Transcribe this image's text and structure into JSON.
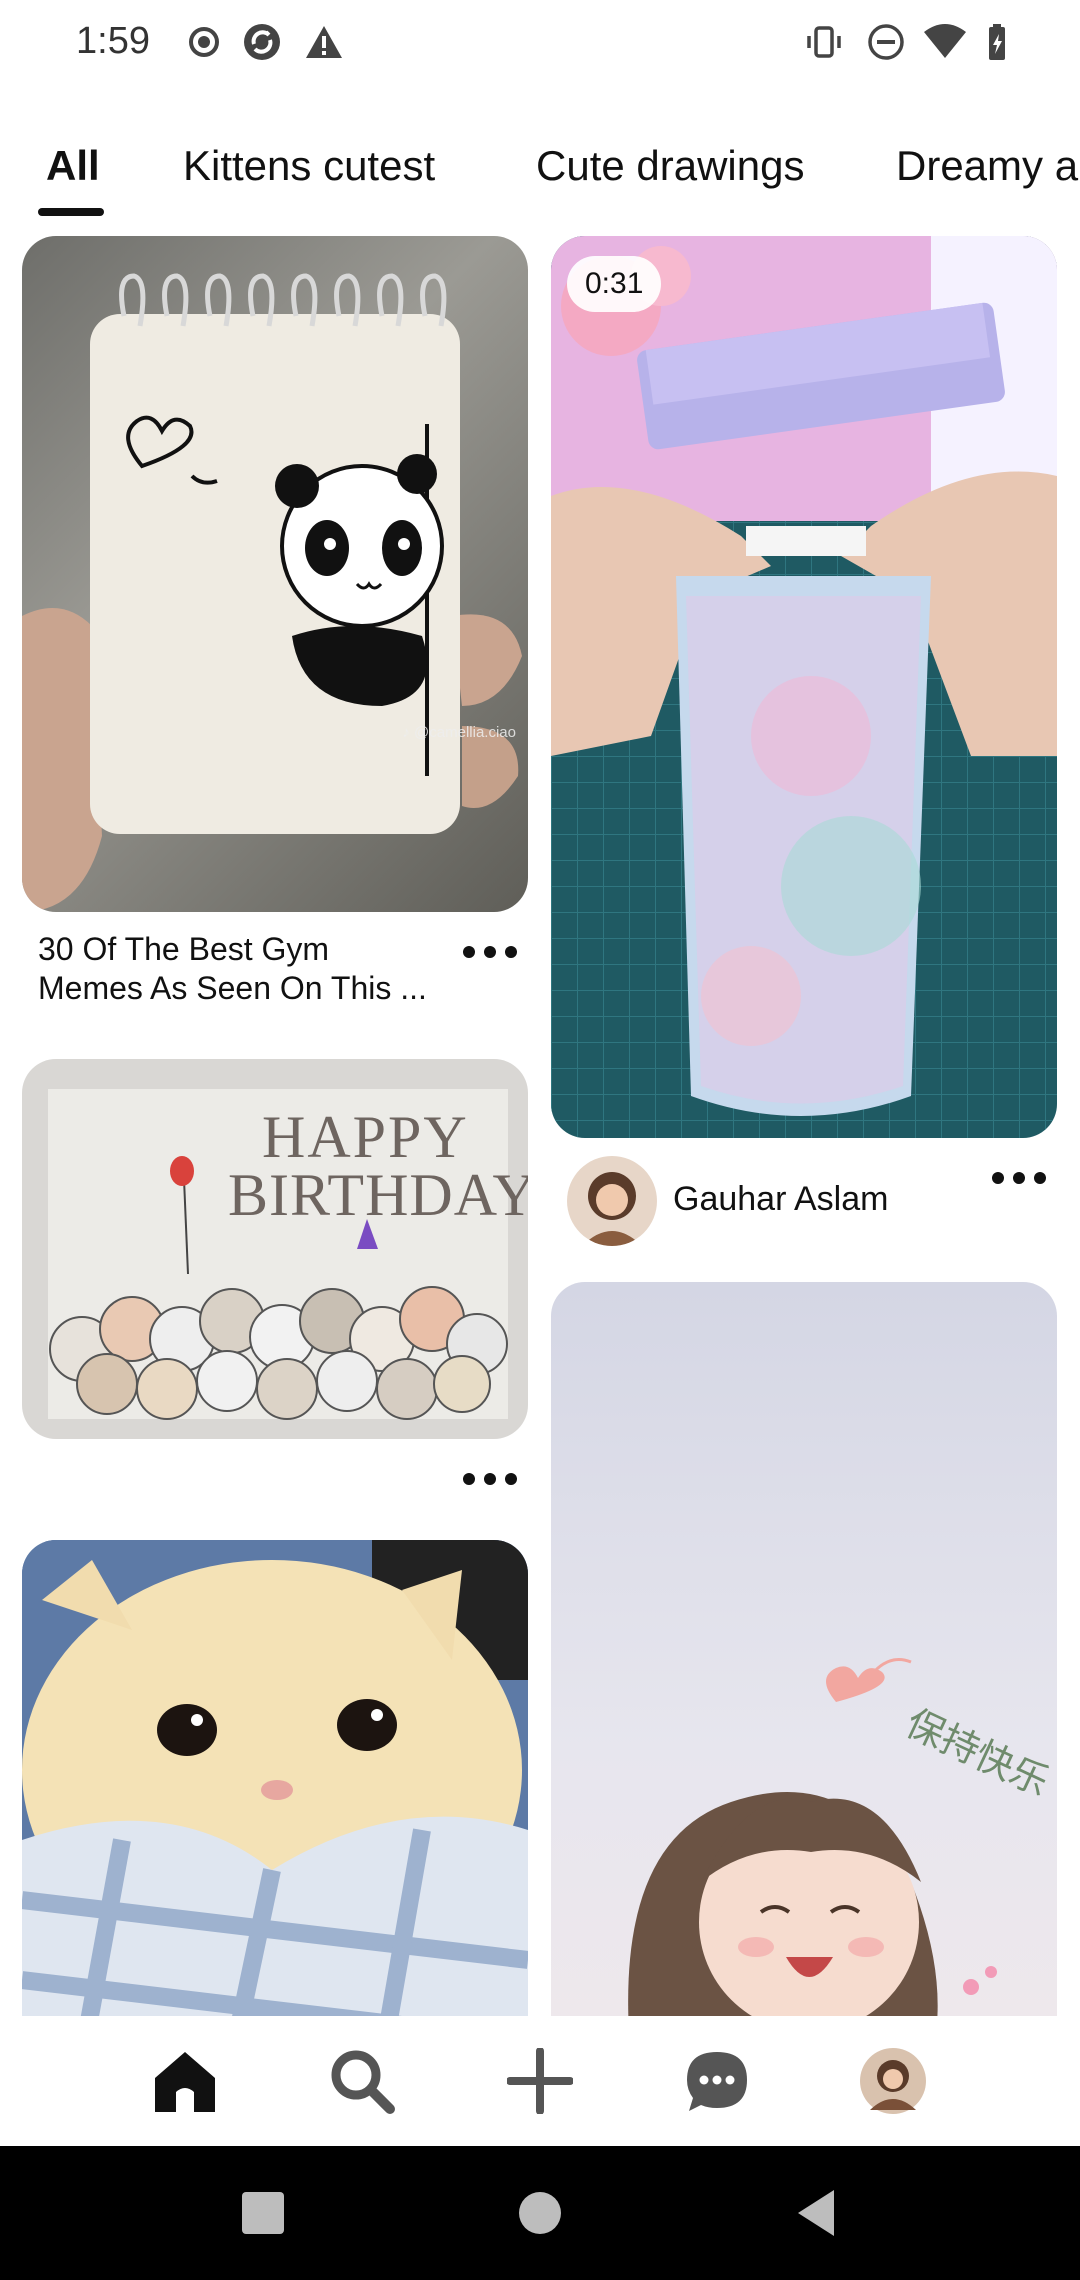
{
  "status_bar": {
    "time": "1:59",
    "icons_left": [
      "record-icon",
      "sync-icon",
      "warning-icon"
    ],
    "icons_right": [
      "vibrate-icon",
      "do-not-disturb-icon",
      "wifi-icon",
      "battery-charging-icon"
    ]
  },
  "tabs": [
    {
      "label": "All",
      "active": true
    },
    {
      "label": "Kittens cutest",
      "active": false
    },
    {
      "label": "Cute drawings",
      "active": false
    },
    {
      "label": "Dreamy a",
      "active": false
    }
  ],
  "feed": {
    "pin1": {
      "title_line1": "30 Of The Best Gym",
      "title_line2": "Memes As Seen On This ...",
      "watermark": "♪ @camellia.ciao"
    },
    "pin2": {
      "video_duration": "0:31",
      "author": "Gauhar Aslam"
    },
    "pin3": {
      "text_line1": "HAPPY",
      "text_line2": "BIRTHDAY"
    },
    "pin4": {},
    "pin5": {
      "handwriting": "保持快乐"
    }
  },
  "bottom_nav": {
    "items": [
      "home-icon",
      "search-icon",
      "create-icon",
      "messages-icon",
      "profile-avatar"
    ],
    "active": "home-icon"
  },
  "colors": {
    "text": "#111111",
    "background": "#ffffff",
    "system_nav": "#000000"
  }
}
